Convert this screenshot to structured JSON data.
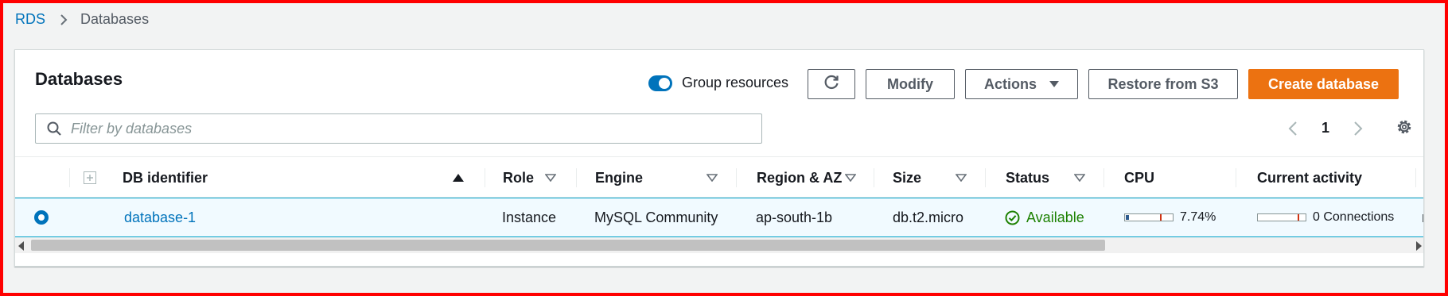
{
  "breadcrumb": {
    "root": "RDS",
    "current": "Databases"
  },
  "panel": {
    "title": "Databases",
    "group_resources_label": "Group resources",
    "group_resources_on": true,
    "buttons": {
      "refresh_icon": "refresh-icon",
      "modify": "Modify",
      "actions": "Actions",
      "restore": "Restore from S3",
      "create": "Create database"
    },
    "search": {
      "placeholder": "Filter by databases",
      "value": ""
    },
    "pagination": {
      "current_page": "1"
    }
  },
  "table": {
    "columns": {
      "db_identifier": "DB identifier",
      "role": "Role",
      "engine": "Engine",
      "region_az": "Region & AZ",
      "size": "Size",
      "status": "Status",
      "cpu": "CPU",
      "current_activity": "Current activity"
    },
    "rows": [
      {
        "selected": true,
        "db_identifier": "database-1",
        "role": "Instance",
        "engine": "MySQL Community",
        "region_az": "ap-south-1b",
        "size": "db.t2.micro",
        "status": "Available",
        "cpu": "7.74%",
        "cpu_fraction": 0.0774,
        "current_activity": "0 Connections",
        "next_col_initial": "n"
      }
    ]
  },
  "colors": {
    "accent": "#0073bb",
    "primary_button": "#ec7211",
    "status_available": "#1d8102",
    "selected_row_bg": "#f1faff",
    "selected_row_border": "#00a1c9",
    "meter_marker": "#d13212"
  }
}
